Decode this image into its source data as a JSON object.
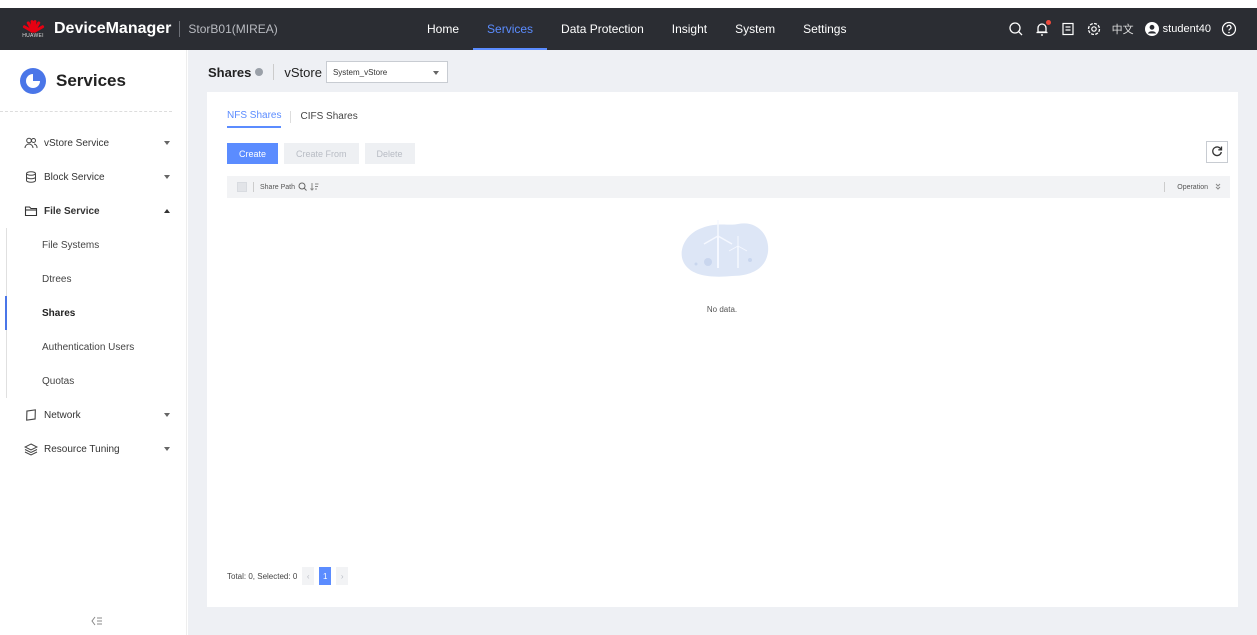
{
  "header": {
    "brand_text": "HUAWEI",
    "app_title": "DeviceManager",
    "device_name": "StorB01(MIREA)",
    "nav": [
      {
        "label": "Home",
        "active": false
      },
      {
        "label": "Services",
        "active": true
      },
      {
        "label": "Data Protection",
        "active": false
      },
      {
        "label": "Insight",
        "active": false
      },
      {
        "label": "System",
        "active": false
      },
      {
        "label": "Settings",
        "active": false
      }
    ],
    "language": "中文",
    "username": "student40"
  },
  "sidebar": {
    "title": "Services",
    "items": [
      {
        "label": "vStore Service",
        "icon": "people-icon"
      },
      {
        "label": "Block Service",
        "icon": "database-icon"
      },
      {
        "label": "File Service",
        "icon": "folder-icon"
      }
    ],
    "file_service_children": [
      {
        "label": "File Systems"
      },
      {
        "label": "Dtrees"
      },
      {
        "label": "Shares",
        "active": true
      },
      {
        "label": "Authentication Users"
      },
      {
        "label": "Quotas"
      }
    ],
    "items_after": [
      {
        "label": "Network",
        "icon": "network-icon"
      },
      {
        "label": "Resource Tuning",
        "icon": "layers-icon"
      }
    ]
  },
  "page": {
    "title": "Shares",
    "vstore_label": "vStore",
    "vstore_value": "System_vStore",
    "tabs": [
      "NFS Shares",
      "CIFS Shares"
    ],
    "buttons": {
      "create": "Create",
      "create_from": "Create From",
      "delete": "Delete"
    },
    "table": {
      "col_share_path": "Share Path",
      "col_operation": "Operation"
    },
    "empty_text": "No data.",
    "pager": {
      "summary": "Total: 0, Selected: 0",
      "current_page": "1"
    }
  },
  "colors": {
    "accent": "#5b8cff",
    "topbar": "#2b2d33",
    "main_bg": "#eef0f4"
  }
}
